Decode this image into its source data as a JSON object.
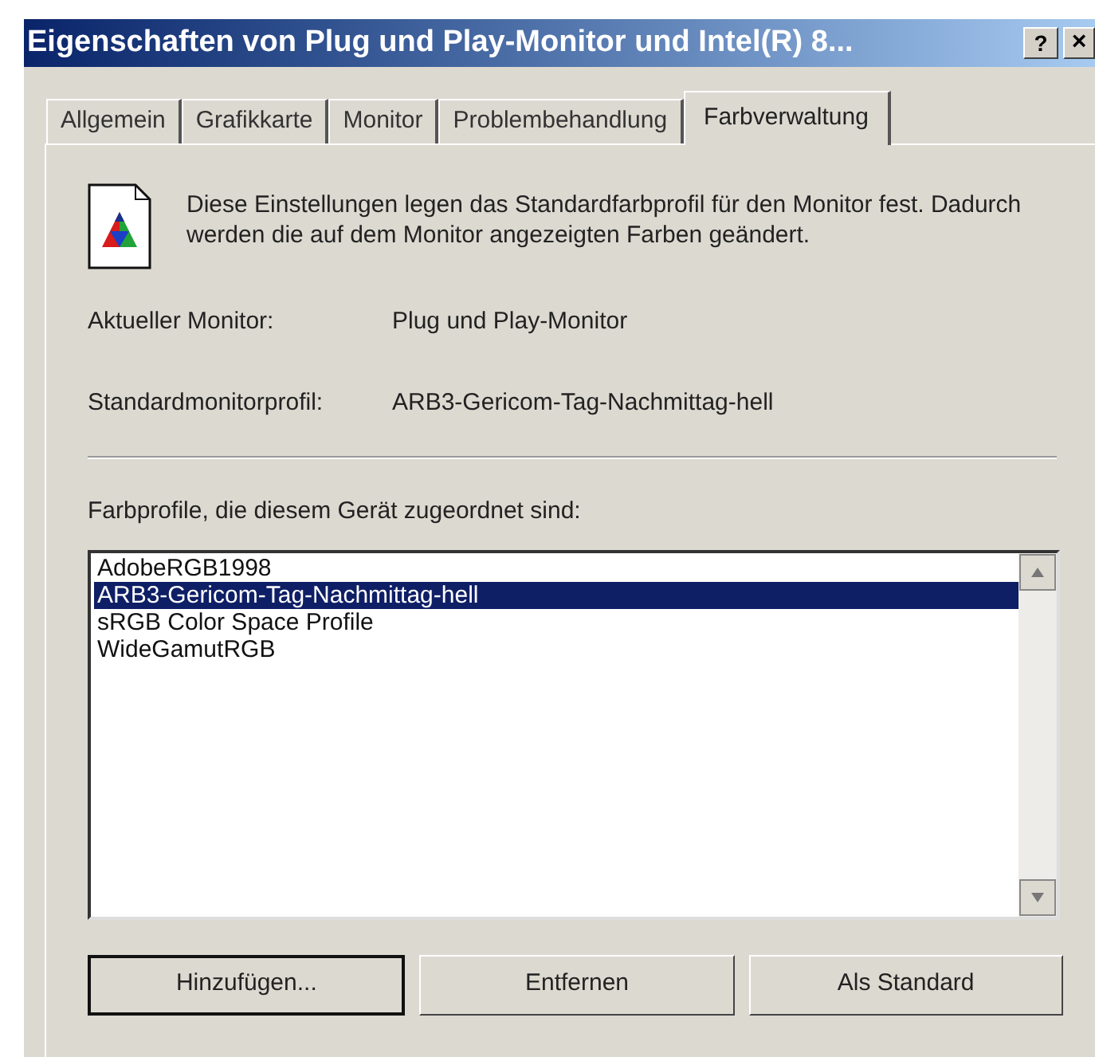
{
  "window": {
    "title": "Eigenschaften von Plug und Play-Monitor und Intel(R) 8...",
    "help_button": "?",
    "close_button": "×"
  },
  "tabs": [
    {
      "label": "Allgemein",
      "selected": false
    },
    {
      "label": "Grafikkarte",
      "selected": false
    },
    {
      "label": "Monitor",
      "selected": false
    },
    {
      "label": "Problembehandlung",
      "selected": false
    },
    {
      "label": "Farbverwaltung",
      "selected": true
    }
  ],
  "description": "Diese Einstellungen legen das Standardfarbprofil für den Monitor fest. Dadurch werden die auf dem Monitor angezeigten Farben geändert.",
  "fields": [
    {
      "label": "Aktueller Monitor:",
      "value": "Plug und Play-Monitor"
    },
    {
      "label": "Standardmonitorprofil:",
      "value": "ARB3-Gericom-Tag-Nachmittag-hell"
    }
  ],
  "profiles_label": "Farbprofile, die diesem Gerät zugeordnet sind:",
  "profiles": [
    {
      "name": "AdobeRGB1998",
      "selected": false
    },
    {
      "name": "ARB3-Gericom-Tag-Nachmittag-hell",
      "selected": true
    },
    {
      "name": "sRGB Color Space Profile",
      "selected": false
    },
    {
      "name": "WideGamutRGB",
      "selected": false
    }
  ],
  "buttons": [
    {
      "label": "Hinzufügen...",
      "default": true
    },
    {
      "label": "Entfernen",
      "default": false
    },
    {
      "label": "Als Standard",
      "default": false
    }
  ]
}
